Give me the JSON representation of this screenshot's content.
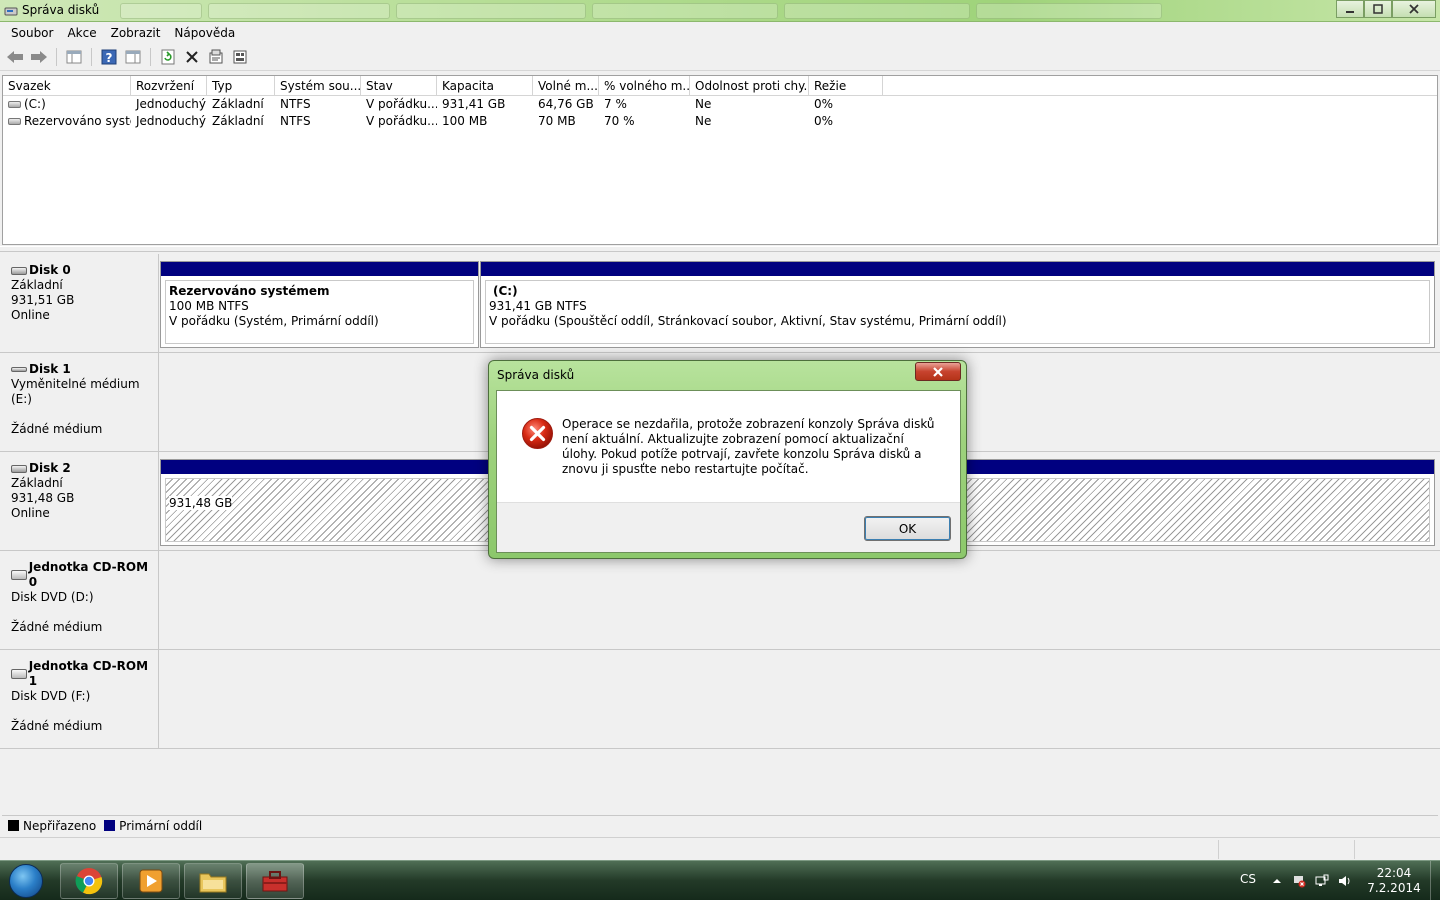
{
  "window": {
    "title": "Správa disků"
  },
  "menu": [
    "Soubor",
    "Akce",
    "Zobrazit",
    "Nápověda"
  ],
  "volumes": {
    "columns": [
      "Svazek",
      "Rozvržení",
      "Typ",
      "Systém sou...",
      "Stav",
      "Kapacita",
      "Volné m...",
      "% volného m...",
      "Odolnost proti chy...",
      "Režie"
    ],
    "rows": [
      [
        "(C:)",
        "Jednoduchý",
        "Základní",
        "NTFS",
        "V pořádku...",
        "931,41 GB",
        "64,76 GB",
        "7 %",
        "Ne",
        "0%"
      ],
      [
        "Rezervováno systé...",
        "Jednoduchý",
        "Základní",
        "NTFS",
        "V pořádku...",
        "100 MB",
        "70 MB",
        "70 %",
        "Ne",
        "0%"
      ]
    ]
  },
  "disks": {
    "disk0": {
      "name": "Disk 0",
      "type": "Základní",
      "size": "931,51 GB",
      "state": "Online",
      "p1": {
        "name": "Rezervováno systémem",
        "size": "100 MB NTFS",
        "status": "V pořádku (Systém, Primární oddíl)"
      },
      "p2": {
        "name": "(C:)",
        "size": "931,41 GB NTFS",
        "status": "V pořádku (Spouštěcí oddíl, Stránkovací soubor, Aktivní, Stav systému, Primární oddíl)"
      }
    },
    "disk1": {
      "name": "Disk 1",
      "type": "Vyměnitelné médium (E:)",
      "state": "Žádné médium"
    },
    "disk2": {
      "name": "Disk 2",
      "type": "Základní",
      "size": "931,48 GB",
      "state": "Online",
      "p1": {
        "size": "931,48 GB"
      }
    },
    "cd0": {
      "name": "Jednotka CD-ROM 0",
      "type": "Disk DVD (D:)",
      "state": "Žádné médium"
    },
    "cd1": {
      "name": "Jednotka CD-ROM 1",
      "type": "Disk DVD (F:)",
      "state": "Žádné médium"
    }
  },
  "legend": {
    "unallocated": "Nepřiřazeno",
    "primary": "Primární oddíl",
    "unallocated_color": "#000000",
    "primary_color": "#00007f"
  },
  "dialog": {
    "title": "Správa disků",
    "message": "Operace se nezdařila, protože zobrazení konzoly Správa disků není aktuální. Aktualizujte zobrazení pomocí aktualizační úlohy. Pokud potíže potrvají, zavřete konzolu Správa disků a znovu ji spusťte nebo restartujte počítač.",
    "ok": "OK",
    "icon": "error-icon"
  },
  "taskbar": {
    "lang": "CS",
    "time": "22:04",
    "date": "7.2.2014"
  }
}
